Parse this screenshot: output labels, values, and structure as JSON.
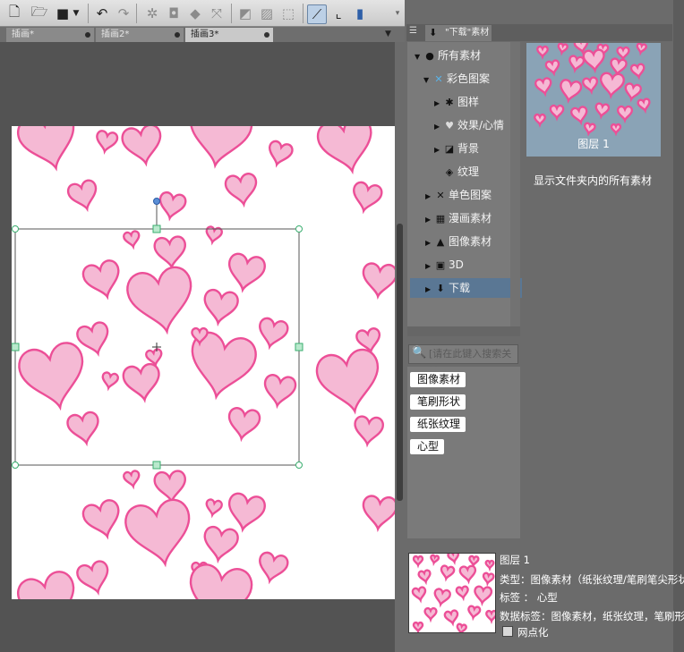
{
  "document_tabs": [
    {
      "label": "插画*"
    },
    {
      "label": "插画2*"
    },
    {
      "label": "插画3*"
    }
  ],
  "material_panel": {
    "tab_label": "\"下载\"素材",
    "tree": [
      {
        "label": "所有素材"
      },
      {
        "label": "彩色图案"
      },
      {
        "label": "图样"
      },
      {
        "label": "效果/心情"
      },
      {
        "label": "背景"
      },
      {
        "label": "纹理"
      },
      {
        "label": "单色图案"
      },
      {
        "label": "漫画素材"
      },
      {
        "label": "图像素材"
      },
      {
        "label": "3D"
      },
      {
        "label": "下载"
      }
    ],
    "preview_label": "图层 1",
    "description": "显示文件夹内的所有素材",
    "search_placeholder": "[请在此键入搜索关键词]",
    "tags": [
      {
        "label": "图像素材"
      },
      {
        "label": "笔刷形状"
      },
      {
        "label": "纸张纹理"
      },
      {
        "label": "心型"
      }
    ]
  },
  "info": {
    "name": "图层 1",
    "type_line": "类型：图像素材（纸张纹理/笔刷笔尖形状）",
    "tag_line": "标签 ： 心型",
    "data_tag_line": "数据标签：图像素材，纸张纹理，笔刷形状",
    "halftone_label": "网点化"
  },
  "colors": {
    "heart_fill": "#f5b9d4",
    "heart_stroke": "#ec4f97",
    "selection_handle": "#3aae6f",
    "rotate_handle": "#5b8fd6"
  },
  "icons": [
    "new-file-icon",
    "open-folder-icon",
    "save-icon",
    "undo-icon",
    "redo-icon",
    "transform-icon",
    "erase-icon",
    "selection-icon",
    "ruler-icon",
    "search-icon",
    "checkbox-icon"
  ]
}
